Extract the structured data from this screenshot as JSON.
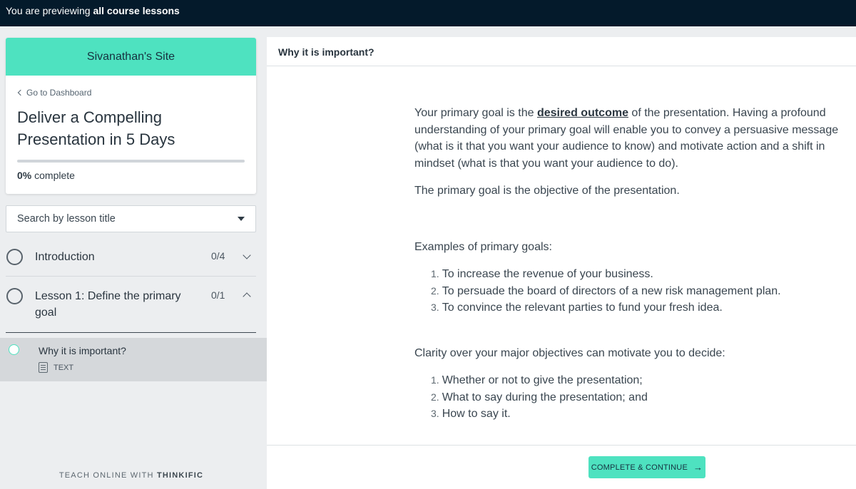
{
  "banner": {
    "prefix": "You are previewing",
    "emphasis": "all course lessons"
  },
  "sidebar": {
    "site_name": "Sivanathan's Site",
    "go_dashboard": "Go to Dashboard",
    "course_title": "Deliver a Compelling Presentation in 5 Days",
    "progress": {
      "percent_label": "0%",
      "suffix": "complete",
      "value": 0
    },
    "search_placeholder": "Search by lesson title",
    "chapters": [
      {
        "title": "Introduction",
        "count": "0/4",
        "expanded": false
      },
      {
        "title": "Lesson 1: Define the primary goal",
        "count": "0/1",
        "expanded": true
      }
    ],
    "active_lesson": {
      "title": "Why it is important?",
      "type": "TEXT"
    },
    "footer": {
      "prefix": "TEACH ONLINE WITH",
      "brand": "THINKIFIC"
    }
  },
  "content": {
    "header": "Why it is important?",
    "p1_pre": "Your primary goal is the ",
    "p1_link": "desired outcome",
    "p1_post": " of the presentation. Having a profound understanding of your primary goal will enable you to convey a persuasive message (what is it that you want your audience to know) and motivate action and a shift in mindset (what is that you want your audience to do).",
    "p2": "The primary goal is the objective of the presentation.",
    "p3": "Examples of primary goals:",
    "list1": [
      "To increase the revenue of your business.",
      "To persuade the board of directors of a new risk management plan.",
      "To convince the relevant parties to fund your fresh idea."
    ],
    "p4": "Clarity over your major objectives can motivate you to decide:",
    "list2": [
      "Whether or not to give the presentation;",
      "What to say during the presentation; and",
      "How to say it."
    ],
    "cta_label": "COMPLETE & CONTINUE",
    "cta_arrow": "→"
  },
  "colors": {
    "accent": "#4ee2c0",
    "topbar": "#041a2b"
  },
  "icons": {
    "back": "chevron-left-icon",
    "dropdown": "caret-down-icon",
    "chapter_status": "circle-outline-icon",
    "lesson_type": "document-icon"
  }
}
